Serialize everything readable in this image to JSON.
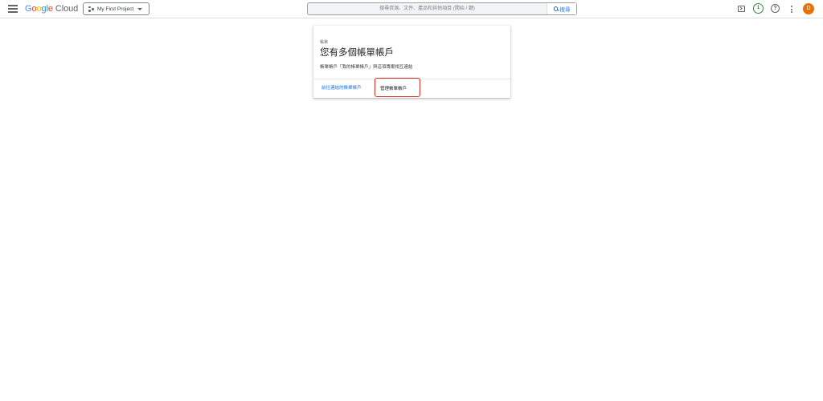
{
  "header": {
    "logo": {
      "google": [
        "G",
        "o",
        "o",
        "g",
        "l",
        "e"
      ],
      "cloud": "Cloud"
    },
    "project_picker_label": "My First Project",
    "search": {
      "placeholder": "搜尋資源、文件、產品和其他項目 (開始 / 鍵)",
      "button_label": "搜尋"
    },
    "notifications_count": "1",
    "avatar_initial": "D",
    "colors": {
      "avatar": "#e8710a",
      "notification_ring": "#1e8e3e",
      "accent": "#1a73e8"
    }
  },
  "card": {
    "eyebrow": "帳單",
    "title": "您有多個帳單帳戶",
    "description": "帳單帳戶「我的帳單帳戶」與這項專案相互連結",
    "links": {
      "goto_linked": "前往連結的帳單帳戶",
      "manage": "管理帳單帳戶"
    },
    "highlight_color": "#d93025"
  }
}
